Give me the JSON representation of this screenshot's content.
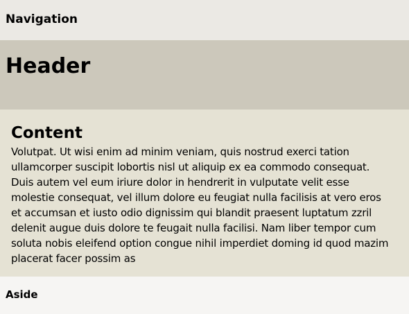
{
  "navigation": {
    "label": "Navigation"
  },
  "header": {
    "title": "Header"
  },
  "content": {
    "title": "Content",
    "body": "Volutpat. Ut wisi enim ad minim veniam, quis nostrud exerci tation ullamcorper suscipit lobortis nisl ut aliquip ex ea commodo consequat. Duis autem vel eum iriure dolor in hendrerit in vulputate velit esse molestie consequat, vel illum dolore eu feugiat nulla facilisis at vero eros et accumsan et iusto odio dignissim qui blandit praesent luptatum zzril delenit augue duis dolore te feugait nulla facilisi. Nam liber tempor cum soluta nobis eleifend option congue nihil imperdiet doming id quod mazim placerat facer possim as"
  },
  "aside": {
    "label": "Aside"
  },
  "colors": {
    "navigation_bg": "#ebe9e4",
    "header_bg": "#ccc8bb",
    "content_bg": "#e5e2d4",
    "aside_bg": "#f6f5f3"
  }
}
